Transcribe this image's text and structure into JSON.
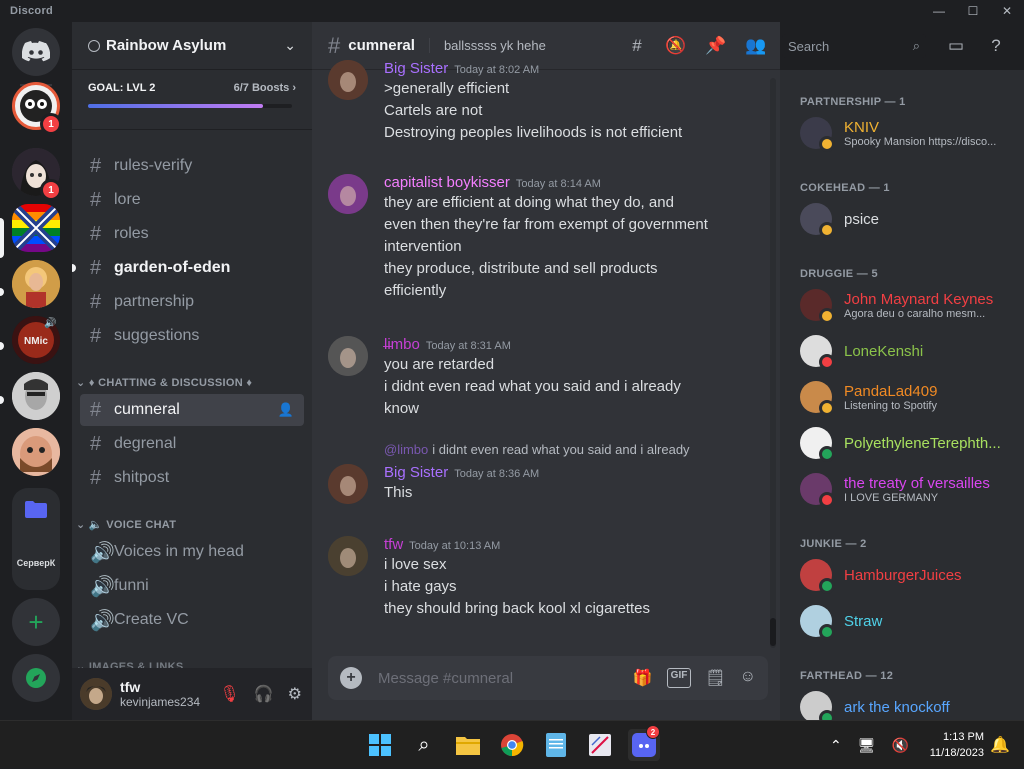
{
  "window": {
    "app_name": "Discord",
    "minimize": "—",
    "maximize": "☐",
    "close": "✕"
  },
  "servers": {
    "folder_label": "СерверК",
    "badges": [
      "1",
      "1"
    ]
  },
  "guild": {
    "name": "Rainbow Asylum",
    "boost_goal": "GOAL: LVL 2",
    "boost_count": "6/7 Boosts",
    "boost_progress": 0.857
  },
  "channels": [
    {
      "name": "rules-verify",
      "state": "normal"
    },
    {
      "name": "lore",
      "state": "normal"
    },
    {
      "name": "roles",
      "state": "normal"
    },
    {
      "name": "garden-of-eden",
      "state": "unread"
    },
    {
      "name": "partnership",
      "state": "normal"
    },
    {
      "name": "suggestions",
      "state": "normal"
    }
  ],
  "categories": {
    "chatting": "♦ CHATTING & DISCUSSION ♦",
    "voice": "VOICE CHAT",
    "images": "IMAGES & LINKS"
  },
  "chat_channels": [
    {
      "name": "cumneral",
      "state": "active"
    },
    {
      "name": "degrenal",
      "state": "normal"
    },
    {
      "name": "shitpost",
      "state": "normal"
    }
  ],
  "voice_channels": [
    "Voices in my head",
    "funni",
    "Create VC"
  ],
  "user_panel": {
    "name": "tfw",
    "tag": "kevinjames234"
  },
  "channel_header": {
    "name": "cumneral",
    "topic": "ballsssss yk hehe",
    "search_placeholder": "Search"
  },
  "messages": [
    {
      "user": "Big Sister",
      "color": "#a970ff",
      "time": "Today at 8:02 AM",
      "lines": [
        ">generally efficient",
        "Cartels are not",
        "Destroying peoples livelihoods is not efficient"
      ]
    },
    {
      "user": "capitalist boykisser",
      "color": "#f47fff",
      "time": "Today at 8:14 AM",
      "lines": [
        "they are efficient at doing what they do, and",
        "even then they're far from exempt of government",
        "intervention",
        "they produce, distribute and sell products",
        "efficiently"
      ]
    },
    {
      "user": "l̶imbo",
      "color": "#c73fd6",
      "time": "Today at 8:31 AM",
      "lines": [
        "you are retarded",
        "i didnt even read what you said and i already",
        "know"
      ]
    },
    {
      "reply_to": "@limbo",
      "reply_text": "i didnt even read what you said and i already",
      "user": "Big Sister",
      "color": "#a970ff",
      "time": "Today at 8:36 AM",
      "lines": [
        "This"
      ]
    },
    {
      "user": "tfw",
      "color": "#c73fd6",
      "time": "Today at 10:13 AM",
      "lines": [
        "i love sex",
        "i hate gays",
        "they should bring back kool xl cigarettes"
      ]
    }
  ],
  "composer": {
    "placeholder": "Message #cumneral",
    "gif": "GIF"
  },
  "members": {
    "categories": [
      "PARTNERSHIP — 1",
      "COKEHEAD — 1",
      "DRUGGIE — 5",
      "JUNKIE — 2",
      "FARTHEAD — 12"
    ],
    "list": [
      {
        "name": "KNIV",
        "color": "#f0b232",
        "status": "Spooky Mansion https://disco...",
        "presence": "#f0b232"
      },
      {
        "name": "psice",
        "color": "#dbdee1",
        "status": "",
        "presence": "#f0b232"
      },
      {
        "name": "John Maynard Keynes",
        "color": "#f23f43",
        "status": "Agora deu o caralho mesm...",
        "presence": "#f0b232"
      },
      {
        "name": "LoneKenshi",
        "color": "#8bc34a",
        "status": "",
        "presence": "#f23f43"
      },
      {
        "name": "PandaLad409",
        "color": "#f08a24",
        "status": "Listening to Spotify",
        "presence": "#f0b232"
      },
      {
        "name": "PolyethyleneTerephth...",
        "color": "#a8e05f",
        "status": "",
        "presence": "#23a55a"
      },
      {
        "name": "the treaty of versailles",
        "color": "#d946ef",
        "status": "I LOVE GERMANY",
        "presence": "#f23f43"
      },
      {
        "name": "HamburgerJuices",
        "color": "#f23f43",
        "status": "",
        "presence": "#23a55a"
      },
      {
        "name": "Straw",
        "color": "#4fd1e8",
        "status": "",
        "presence": "#23a55a"
      },
      {
        "name": "ark the knockoff",
        "color": "#58a6ff",
        "status": "",
        "presence": "#23a55a"
      }
    ]
  },
  "taskbar": {
    "time": "1:13 PM",
    "date": "11/18/2023",
    "discord_badge": "2"
  }
}
